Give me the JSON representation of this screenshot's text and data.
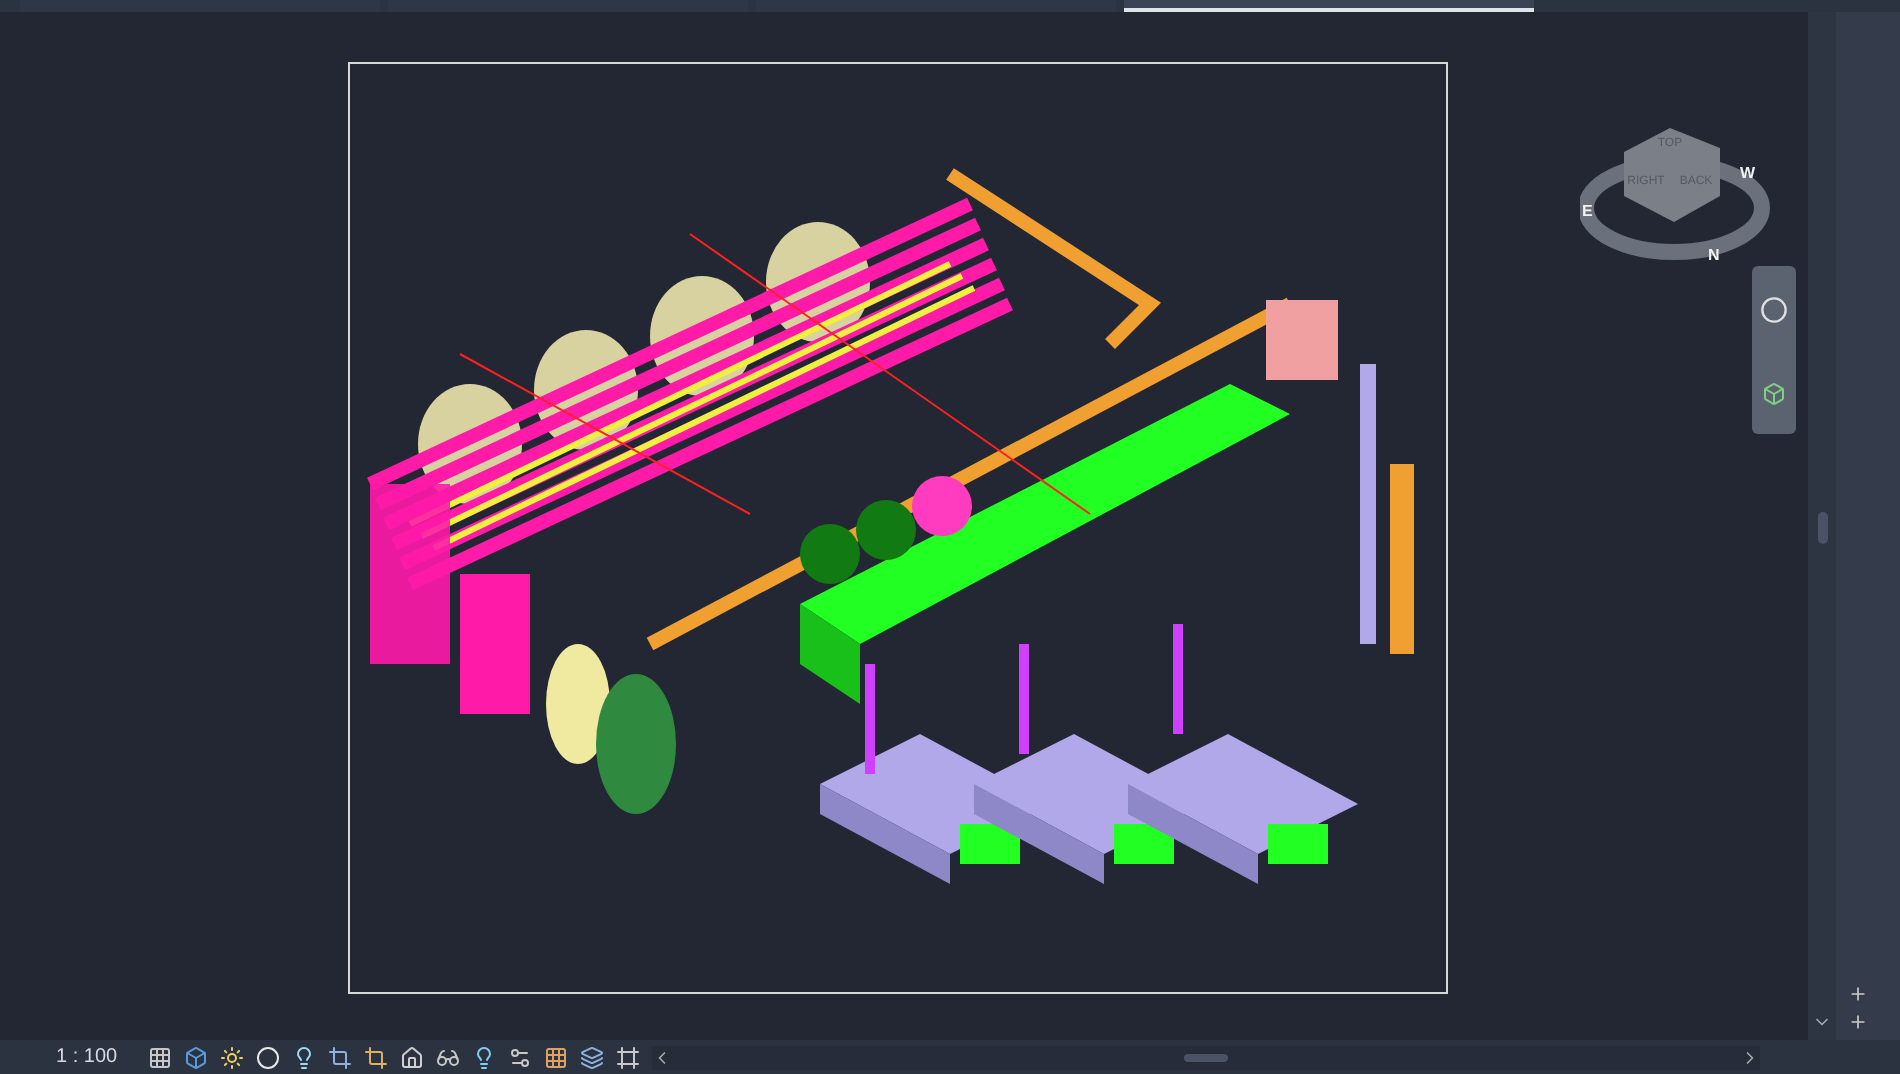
{
  "tabs": [
    {
      "selected": false
    },
    {
      "selected": false
    },
    {
      "selected": false
    },
    {
      "selected": true
    }
  ],
  "view_cube": {
    "faces": [
      "TOP",
      "RIGHT",
      "BACK"
    ],
    "compass": [
      "E",
      "N",
      "W"
    ]
  },
  "status_bar": {
    "scale": "1 : 100"
  }
}
